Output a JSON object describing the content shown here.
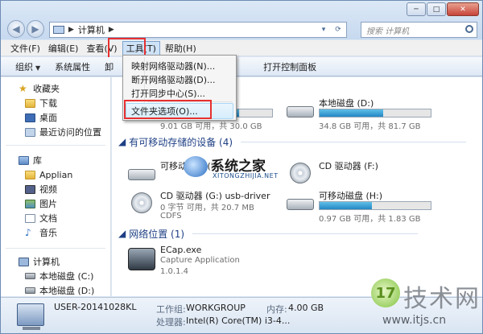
{
  "window": {
    "controls": [
      "─",
      "□",
      "✕"
    ],
    "address": {
      "location": "计算机",
      "dropdown": "▾",
      "refresh": "⟳"
    },
    "search_placeholder": "搜索 计算机"
  },
  "menubar": {
    "items": [
      "文件(F)",
      "编辑(E)",
      "查看(V)",
      "工具(T)",
      "帮助(H)"
    ],
    "active": "工具(T)"
  },
  "toolbar": {
    "organize": "组织",
    "system_props": "系统属性",
    "partial": "卸",
    "open_control_panel": "打开控制面板"
  },
  "tools_menu": {
    "items": [
      "映射网络驱动器(N)...",
      "断开网络驱动器(D)...",
      "打开同步中心(S)...",
      "文件夹选项(O)..."
    ]
  },
  "sidebar": {
    "favorites": {
      "label": "收藏夹",
      "items": [
        "下载",
        "桌面",
        "最近访问的位置"
      ]
    },
    "libraries": {
      "label": "库",
      "items": [
        "Applian",
        "视频",
        "图片",
        "文档",
        "音乐"
      ]
    },
    "computer": {
      "label": "计算机",
      "items": [
        "本地磁盘 (C:)",
        "本地磁盘 (D:)"
      ]
    }
  },
  "main": {
    "drives_c": {
      "sub": "9.01 GB 可用，共 30.0 GB",
      "used_fraction": 0.7
    },
    "drives_d": {
      "name": "本地磁盘 (D:)",
      "sub": "34.8 GB 可用，共 81.7 GB",
      "used_fraction": 0.57
    },
    "removable_header": "有可移动存储的设备 (4)",
    "removable": [
      {
        "name": "可移动磁盘 (E:)"
      },
      {
        "name": "CD 驱动器 (F:)"
      },
      {
        "name": "CD 驱动器 (G:) usb-driver",
        "line2": "0 字节 可用，共 20.7 MB",
        "line3": "CDFS"
      },
      {
        "name": "可移动磁盘 (H:)",
        "sub": "0.97 GB 可用，共 1.83 GB",
        "used_fraction": 0.47
      }
    ],
    "network_header": "网络位置 (1)",
    "network": [
      {
        "name": "ECap.exe",
        "line2": "Capture Application",
        "line3": "1.0.1.4"
      }
    ]
  },
  "status": {
    "computer_name": "USER-20141028KL",
    "workgroup_label": "工作组:",
    "workgroup": "WORKGROUP",
    "memory_label": "内存:",
    "memory": "4.00 GB",
    "cpu_label": "处理器:",
    "cpu": "Intel(R) Core(TM) i3-4..."
  },
  "watermarks": {
    "center_title": "系统之家",
    "center_url": "XITONGZHIJIA.NET",
    "br_symbol": "17",
    "br_text": "技术网",
    "br_url": "www.itjs.cn"
  },
  "colors": {
    "highlight_red": "#e82f2f",
    "link_blue": "#1e3f84"
  }
}
